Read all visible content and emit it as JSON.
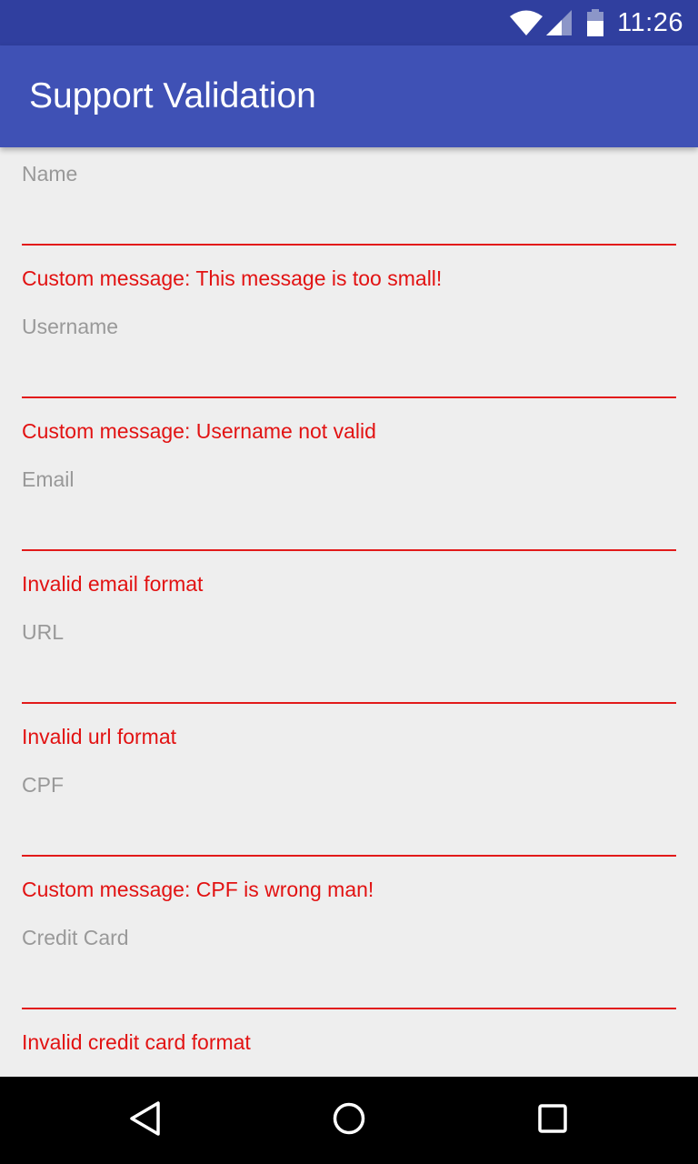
{
  "status_bar": {
    "time": "11:26",
    "icons": [
      "wifi-icon",
      "cell-signal-icon",
      "battery-icon"
    ]
  },
  "app_bar": {
    "title": "Support Validation",
    "color": "#3f51b5"
  },
  "form": {
    "fields": [
      {
        "label": "Name",
        "value": "",
        "error": "Custom message: This message is too small!"
      },
      {
        "label": "Username",
        "value": "",
        "error": "Custom message: Username not valid"
      },
      {
        "label": "Email",
        "value": "",
        "error": "Invalid email format"
      },
      {
        "label": "URL",
        "value": "",
        "error": "Invalid url format"
      },
      {
        "label": "CPF",
        "value": "",
        "error": "Custom message: CPF is wrong man!"
      },
      {
        "label": "Credit Card",
        "value": "",
        "error": "Invalid credit card format"
      }
    ],
    "error_color": "#e21212"
  },
  "nav_bar": {
    "buttons": [
      "back-icon",
      "home-icon",
      "recents-icon"
    ]
  }
}
